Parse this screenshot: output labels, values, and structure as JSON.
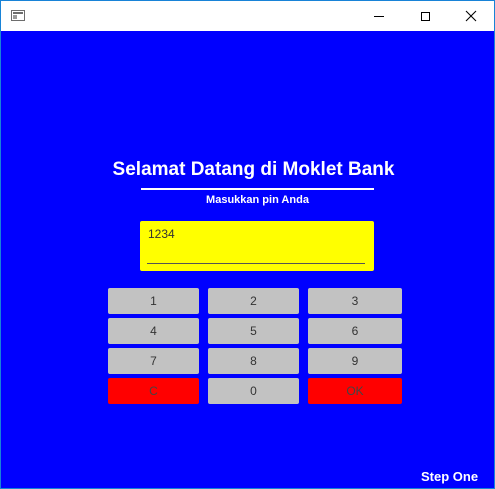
{
  "window": {
    "minimize_icon": "minimize-icon",
    "maximize_icon": "maximize-icon",
    "close_icon": "close-icon"
  },
  "header": {
    "title": "Selamat Datang di Moklet Bank",
    "subtitle": "Masukkan pin Anda"
  },
  "pin_field": {
    "value": "1234"
  },
  "keypad": {
    "keys": [
      "1",
      "2",
      "3",
      "4",
      "5",
      "6",
      "7",
      "8",
      "9",
      "C",
      "0",
      "OK"
    ]
  },
  "footer": {
    "step_label": "Step One"
  },
  "colors": {
    "background": "#0000ff",
    "pin_field": "#ffff00",
    "key": "#c2c2c2",
    "key_danger": "#ff0000"
  }
}
